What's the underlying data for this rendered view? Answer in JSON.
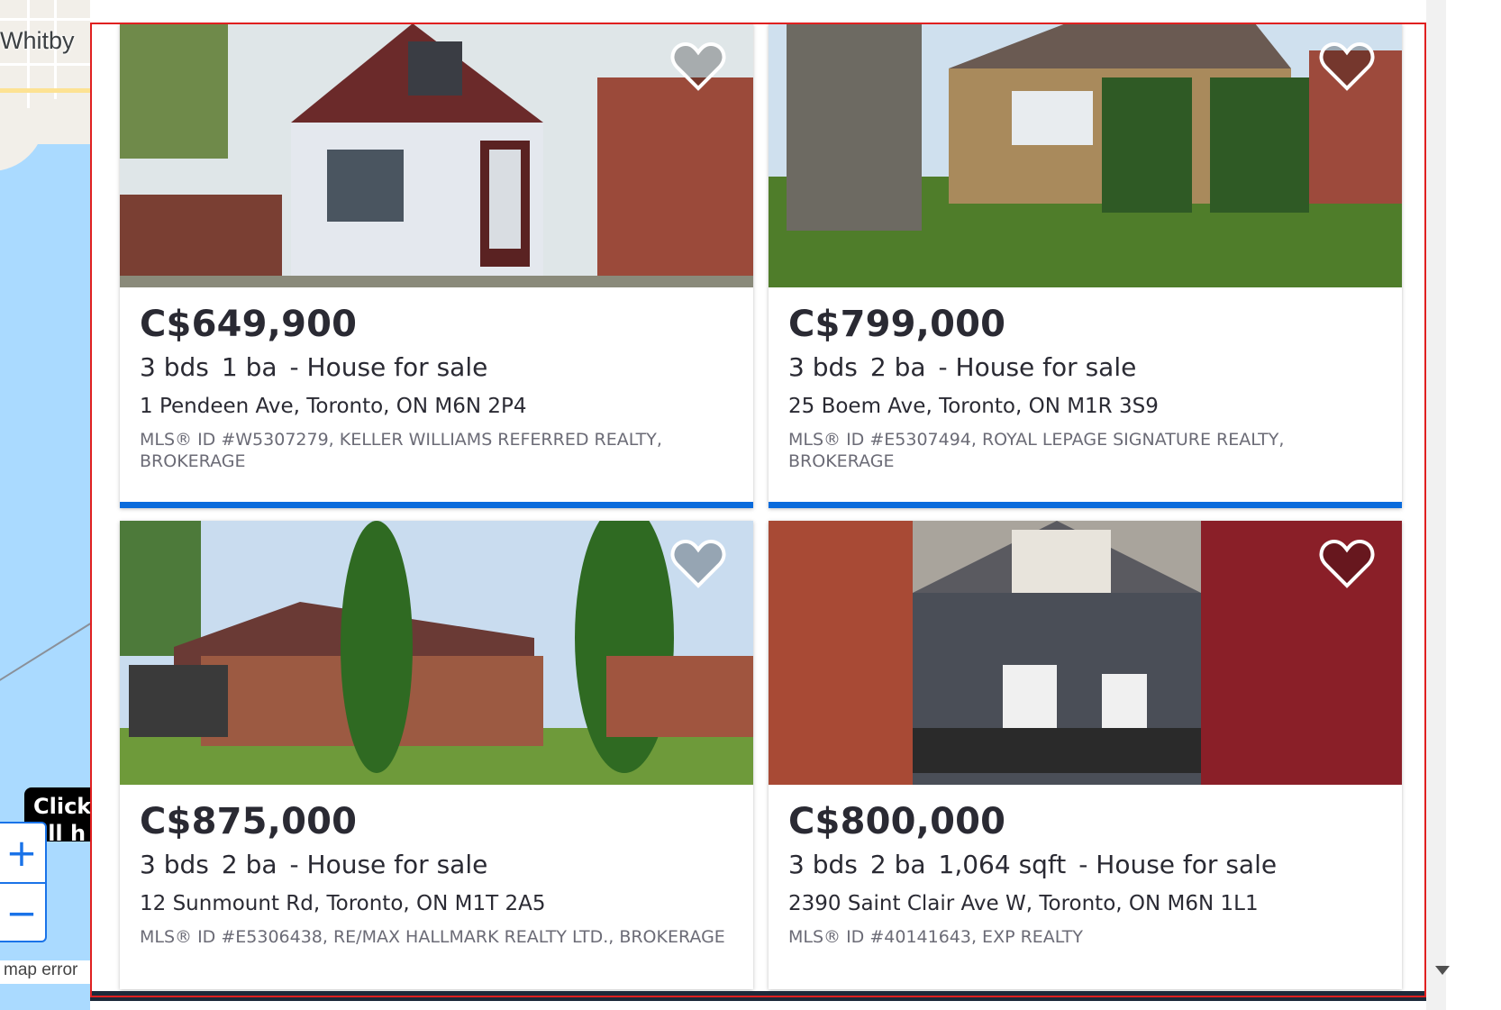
{
  "map": {
    "city_label": "Whitby",
    "tooltip": "Click\nall h",
    "zoom_in": "+",
    "zoom_out": "−",
    "error_text": "map error"
  },
  "colors": {
    "accent": "#0a6bdc",
    "outline": "#e02020",
    "map_water": "#aadaff"
  },
  "listings": [
    {
      "price": "C$649,900",
      "beds": "3 bds",
      "baths": "1 ba",
      "sqft": "",
      "type": "- House for sale",
      "address": "1 Pendeen Ave, Toronto, ON M6N 2P4",
      "mls": "MLS® ID #W5307279, KELLER WILLIAMS REFERRED REALTY, BROKERAGE",
      "favorite_icon": "heart-icon"
    },
    {
      "price": "C$799,000",
      "beds": "3 bds",
      "baths": "2 ba",
      "sqft": "",
      "type": "- House for sale",
      "address": "25 Boem Ave, Toronto, ON M1R 3S9",
      "mls": "MLS® ID #E5307494, ROYAL LEPAGE SIGNATURE REALTY, BROKERAGE",
      "favorite_icon": "heart-icon"
    },
    {
      "price": "C$875,000",
      "beds": "3 bds",
      "baths": "2 ba",
      "sqft": "",
      "type": "- House for sale",
      "address": "12 Sunmount Rd, Toronto, ON M1T 2A5",
      "mls": "MLS® ID #E5306438, RE/MAX HALLMARK REALTY LTD., BROKERAGE",
      "favorite_icon": "heart-icon"
    },
    {
      "price": "C$800,000",
      "beds": "3 bds",
      "baths": "2 ba",
      "sqft": "1,064 sqft",
      "type": "- House for sale",
      "address": "2390 Saint Clair Ave W, Toronto, ON M6N 1L1",
      "mls": "MLS® ID #40141643, EXP REALTY",
      "favorite_icon": "heart-icon"
    }
  ]
}
